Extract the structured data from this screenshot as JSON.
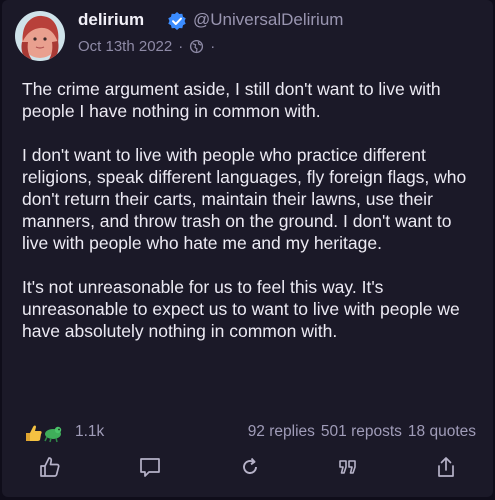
{
  "author": {
    "display_name": "delirium",
    "handle": "@UniversalDelirium",
    "verified_icon": "verified-check-icon"
  },
  "meta": {
    "date": "Oct 13th 2022",
    "separator": "·",
    "visibility_icon": "globe-icon"
  },
  "post": {
    "paragraphs": [
      "The crime argument aside, I still don't want to live with people I have nothing in common with.",
      "I don't want to live with people who practice different religions, speak different languages, fly foreign flags, who don't return their carts, maintain their lawns, use their manners, and throw trash on the ground. I don't want to live with people who hate me and my heritage.",
      "It's not unreasonable for us to feel this way. It's unreasonable to expect us to want to live with people we have absolutely nothing in common with."
    ]
  },
  "stats": {
    "likes": "1.1k",
    "replies": "92 replies",
    "reposts": "501 reposts",
    "quotes": "18 quotes"
  },
  "actions": {
    "icons": [
      "thumbs-up-icon",
      "comment-icon",
      "repost-icon",
      "quote-icon",
      "share-icon"
    ]
  },
  "colors": {
    "background": "#1b1928",
    "text": "#eceaf3",
    "muted": "#8e8aa6",
    "verified": "#3b8cff"
  }
}
